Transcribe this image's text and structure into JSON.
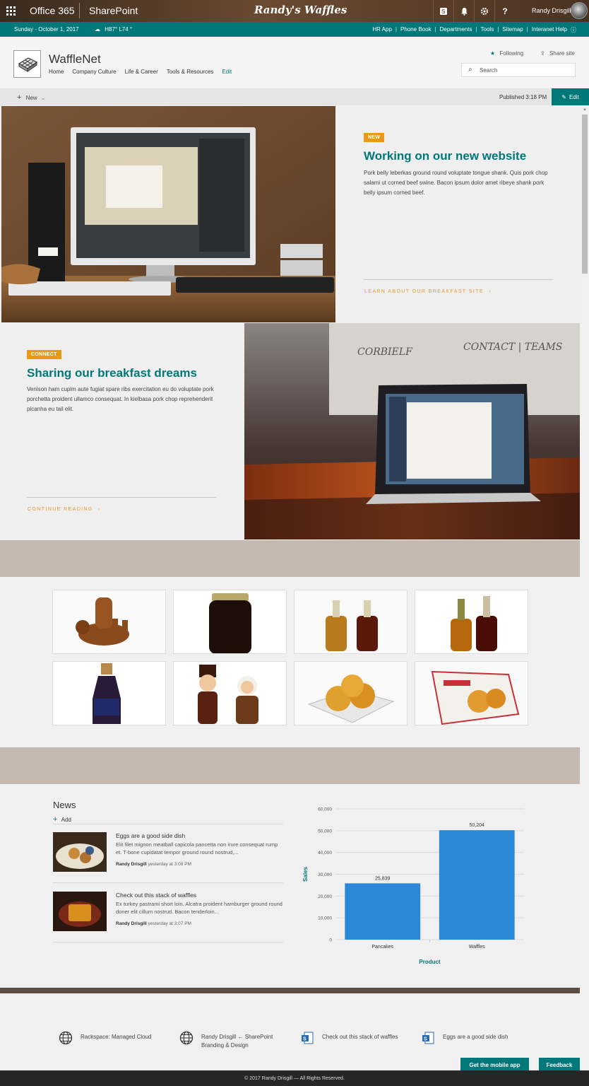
{
  "suite": {
    "app": "Office 365",
    "product": "SharePoint",
    "brand": "Randy's Waffles",
    "user": "Randy Drisgill"
  },
  "topnav": {
    "date": "Sunday - October 1, 2017",
    "weather": "H87° L74 °",
    "links": [
      "HR App",
      "Phone Book",
      "Departments",
      "Tools",
      "Sitemap",
      "Interanet Help"
    ]
  },
  "site": {
    "title": "WaffleNet",
    "nav": [
      "Home",
      "Company Culture",
      "Life & Career",
      "Tools & Resources"
    ],
    "nav_edit": "Edit",
    "following": "Following",
    "share": "Share site",
    "search_placeholder": "Search"
  },
  "command_bar": {
    "new": "New",
    "published": "Published 3:18 PM",
    "edit": "Edit"
  },
  "hero1": {
    "tag": "NEW",
    "title": "Working on our new website",
    "body": "Pork belly leberkas ground round voluptate tongue shank. Quis pork chop salami ut corned beef swine. Bacon ipsum dolor amet ribeye shank pork belly ipsum corned beef.",
    "link": "LEARN ABOUT OUR BREAKFAST SITE"
  },
  "hero2": {
    "tag": "CONNECT",
    "title": "Sharing our breakfast dreams",
    "body": "Venison ham cupim aute fugiat spare ribs exercitation eu do voluptate pork porchetta proident ullamco consequat. In kielbasa pork chop reprehenderit picanha eu tail elit.",
    "link": "CONTINUE READING",
    "whiteboard_left": "CORBIELF",
    "whiteboard_right": "CONTACT | TEAMS"
  },
  "news": {
    "heading": "News",
    "add": "Add",
    "items": [
      {
        "title": "Eggs are a good side dish",
        "body": "Elit filet mignon meatball capicola pancetta non irure consequat rump et. T-bone cupidatat tempor ground round nostrud,...",
        "author": "Randy Drisgill",
        "time": "yesterday at 3:08 PM"
      },
      {
        "title": "Check out this stack of waffles",
        "body": "Ex turkey pastrami short loin. Alcatra proident hamburger ground round doner elit cillum nostrud. Bacon tenderloin...",
        "author": "Randy Drisgill",
        "time": "yesterday at 3:07 PM"
      }
    ]
  },
  "chart_data": {
    "type": "bar",
    "categories": [
      "Pancakes",
      "Waffles"
    ],
    "values": [
      25839,
      50204
    ],
    "value_labels": [
      "25,839",
      "50,204"
    ],
    "xlabel": "Product",
    "ylabel": "Sales",
    "ylim": [
      0,
      60000
    ],
    "yticks": [
      0,
      10000,
      20000,
      30000,
      40000,
      50000,
      60000
    ],
    "ytick_labels": [
      "0",
      "10,000",
      "20,000",
      "30,000",
      "40,000",
      "50,000",
      "60,000"
    ],
    "bar_color": "#2b88d8",
    "grid": true
  },
  "footer": {
    "links": [
      {
        "label": "Rackspace: Managed Cloud",
        "icon": "globe-icon"
      },
      {
        "label": "Randy Drisgill ← SharePoint Branding & Design",
        "icon": "globe-icon"
      },
      {
        "label": "Check out this stack of waffles",
        "icon": "sharepoint-page-icon"
      },
      {
        "label": "Eggs are a good side dish",
        "icon": "sharepoint-page-icon"
      }
    ],
    "copyright": "© 2017 Randy Drisgill — All Rights Reserved.",
    "mobile_app": "Get the mobile app",
    "feedback": "Feedback"
  },
  "colors": {
    "accent": "#00787a",
    "tag": "#e79a16",
    "band": "#c4b9b0",
    "footer_rule": "#5c4d45",
    "bar": "#2b88d8"
  }
}
